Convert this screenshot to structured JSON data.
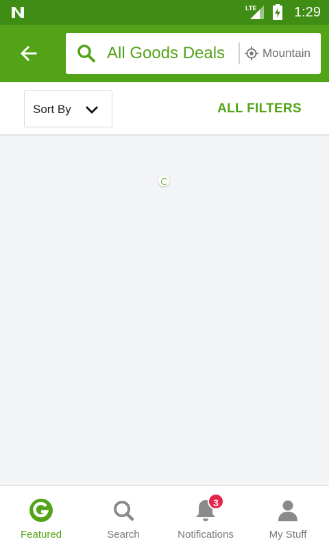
{
  "status_bar": {
    "network": "LTE",
    "time": "1:29"
  },
  "app_bar": {
    "search_text": "All Goods Deals",
    "location_text": "Mountain"
  },
  "filter_bar": {
    "sort_label": "Sort By",
    "all_filters_label": "ALL FILTERS"
  },
  "bottom_nav": {
    "items": [
      {
        "label": "Featured",
        "icon": "groupon-g-icon",
        "active": true
      },
      {
        "label": "Search",
        "icon": "search-icon",
        "active": false
      },
      {
        "label": "Notifications",
        "icon": "bell-icon",
        "active": false
      },
      {
        "label": "My Stuff",
        "icon": "person-icon",
        "active": false
      }
    ],
    "notifications_badge": "3"
  },
  "colors": {
    "status_bar": "#3f8d14",
    "brand_green": "#53a318",
    "badge_red": "#e6254c",
    "background": "#f3f4f6"
  }
}
